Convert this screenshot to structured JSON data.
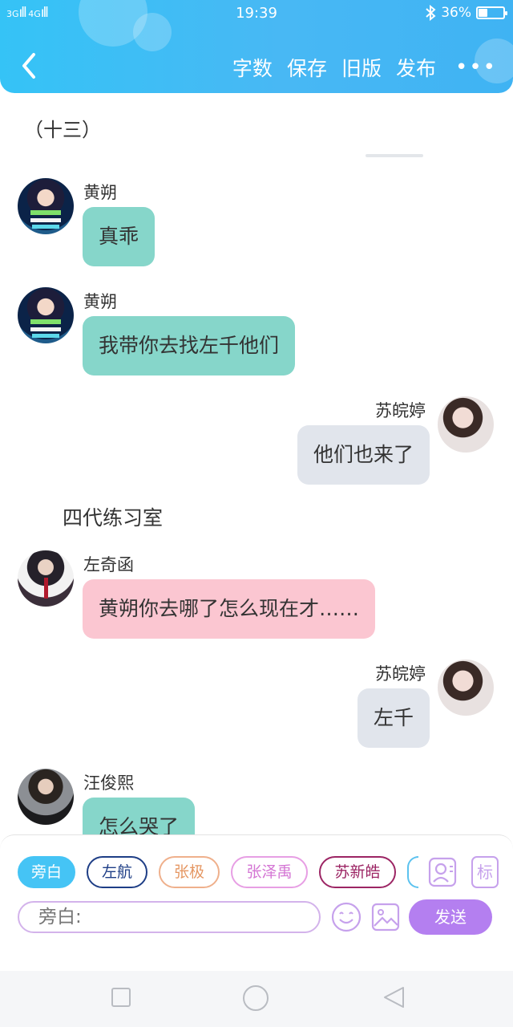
{
  "status_bar": {
    "signal_left": "3G",
    "signal_right": "4G",
    "time": "19:39",
    "bluetooth_icon": "bluetooth-icon",
    "battery_percent": "36%",
    "battery_level": 0.36
  },
  "header": {
    "actions": [
      "字数",
      "保存",
      "旧版",
      "发布"
    ],
    "more": "•••"
  },
  "chat": {
    "chapter_title": "（十三）",
    "messages": [
      {
        "name": "黄朔",
        "text": "真乖"
      },
      {
        "name": "黄朔",
        "text": "我带你去找左千他们"
      },
      {
        "name": "苏皖婷",
        "text": "他们也来了"
      },
      {
        "narration": "四代练习室"
      },
      {
        "name": "左奇函",
        "text": "黄朔你去哪了怎么现在才……"
      },
      {
        "name": "苏皖婷",
        "text": "左千"
      },
      {
        "name": "汪俊熙",
        "text": "怎么哭了"
      }
    ]
  },
  "input_panel": {
    "chips": [
      "旁白",
      "左航",
      "张极",
      "张泽禹",
      "苏新皓"
    ],
    "active_chip": "旁白",
    "input_placeholder": "旁白:",
    "icon_tag": "标",
    "send_label": "发送"
  },
  "colors": {
    "header": "#3fbcf5",
    "bubble_teal": "#86d6ca",
    "bubble_gray": "#e1e5ec",
    "bubble_pink": "#fbc6d1",
    "send": "#b47ff0"
  }
}
